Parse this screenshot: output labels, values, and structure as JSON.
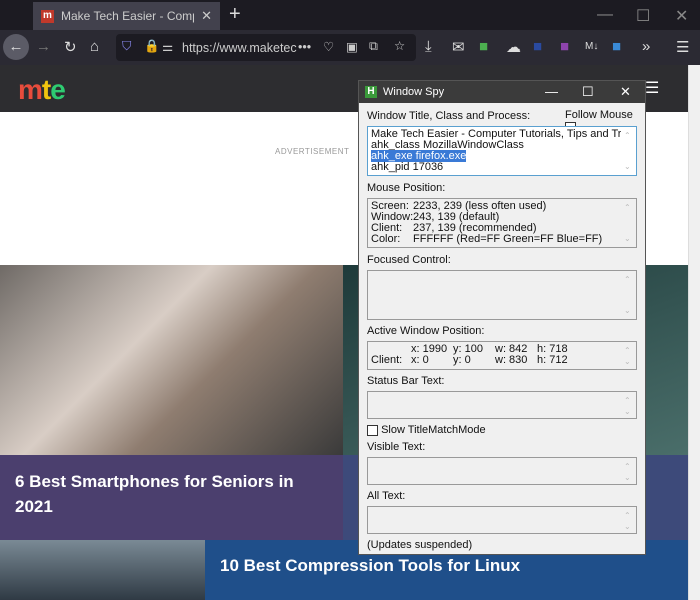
{
  "browser": {
    "tab_title": "Make Tech Easier - Computer T",
    "favicon": "m",
    "url": "https://www.maketec",
    "url_bold": "maketec",
    "new_tab": "+",
    "page_actions": "•••"
  },
  "site": {
    "logo": [
      "m",
      "t",
      "e"
    ],
    "logo_colors": [
      "#e74c3c",
      "#f1c40f",
      "#2ecc71"
    ],
    "advertisement": "ADVERTISEMENT",
    "menu": "☰"
  },
  "cards": [
    {
      "title": "6 Best Smartphones for Seniors in 2021"
    },
    {
      "title": "10 Best Compression Tools for Linux"
    }
  ],
  "spy": {
    "title": "Window Spy",
    "icon": "H",
    "section_title": "Window Title, Class and Process:",
    "follow_mouse": "Follow Mouse",
    "window_info": [
      "Make Tech Easier - Computer Tutorials, Tips and Tricks – Firefox",
      "ahk_class MozillaWindowClass",
      "ahk_exe firefox.exe",
      "ahk_pid 17036"
    ],
    "mouse_label": "Mouse Position:",
    "mouse": [
      [
        "Screen:",
        "2233, 239 (less often used)"
      ],
      [
        "Window:",
        "243, 139 (default)"
      ],
      [
        "Client:",
        "237, 139 (recommended)"
      ],
      [
        "Color:",
        "FFFFFF (Red=FF Green=FF Blue=FF)"
      ]
    ],
    "focused_label": "Focused Control:",
    "active_label": "Active Window Position:",
    "active": [
      [
        "",
        "x: 1990",
        "y: 100",
        "w: 842",
        "h: 718"
      ],
      [
        "Client:",
        "x: 0",
        "y: 0",
        "w: 830",
        "h: 712"
      ]
    ],
    "status_label": "Status Bar Text:",
    "slow_label": "Slow TitleMatchMode",
    "visible_label": "Visible Text:",
    "all_label": "All Text:",
    "footer": "(Updates suspended)"
  }
}
